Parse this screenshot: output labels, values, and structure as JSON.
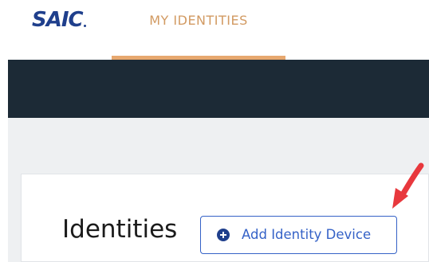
{
  "header": {
    "logo_text": "SAIC",
    "nav_tab_label": "MY IDENTITIES"
  },
  "main": {
    "heading": "Identities",
    "add_button_label": "Add Identity Device"
  },
  "colors": {
    "brand_blue": "#1f3f8c",
    "nav_accent": "#e7a86f",
    "dark_band": "#1c2a36",
    "button_blue": "#3562c7",
    "annotation_arrow": "#e8383d"
  },
  "icons": {
    "add_button_icon": "plus-circle-icon",
    "annotation": "red-arrow-icon"
  }
}
